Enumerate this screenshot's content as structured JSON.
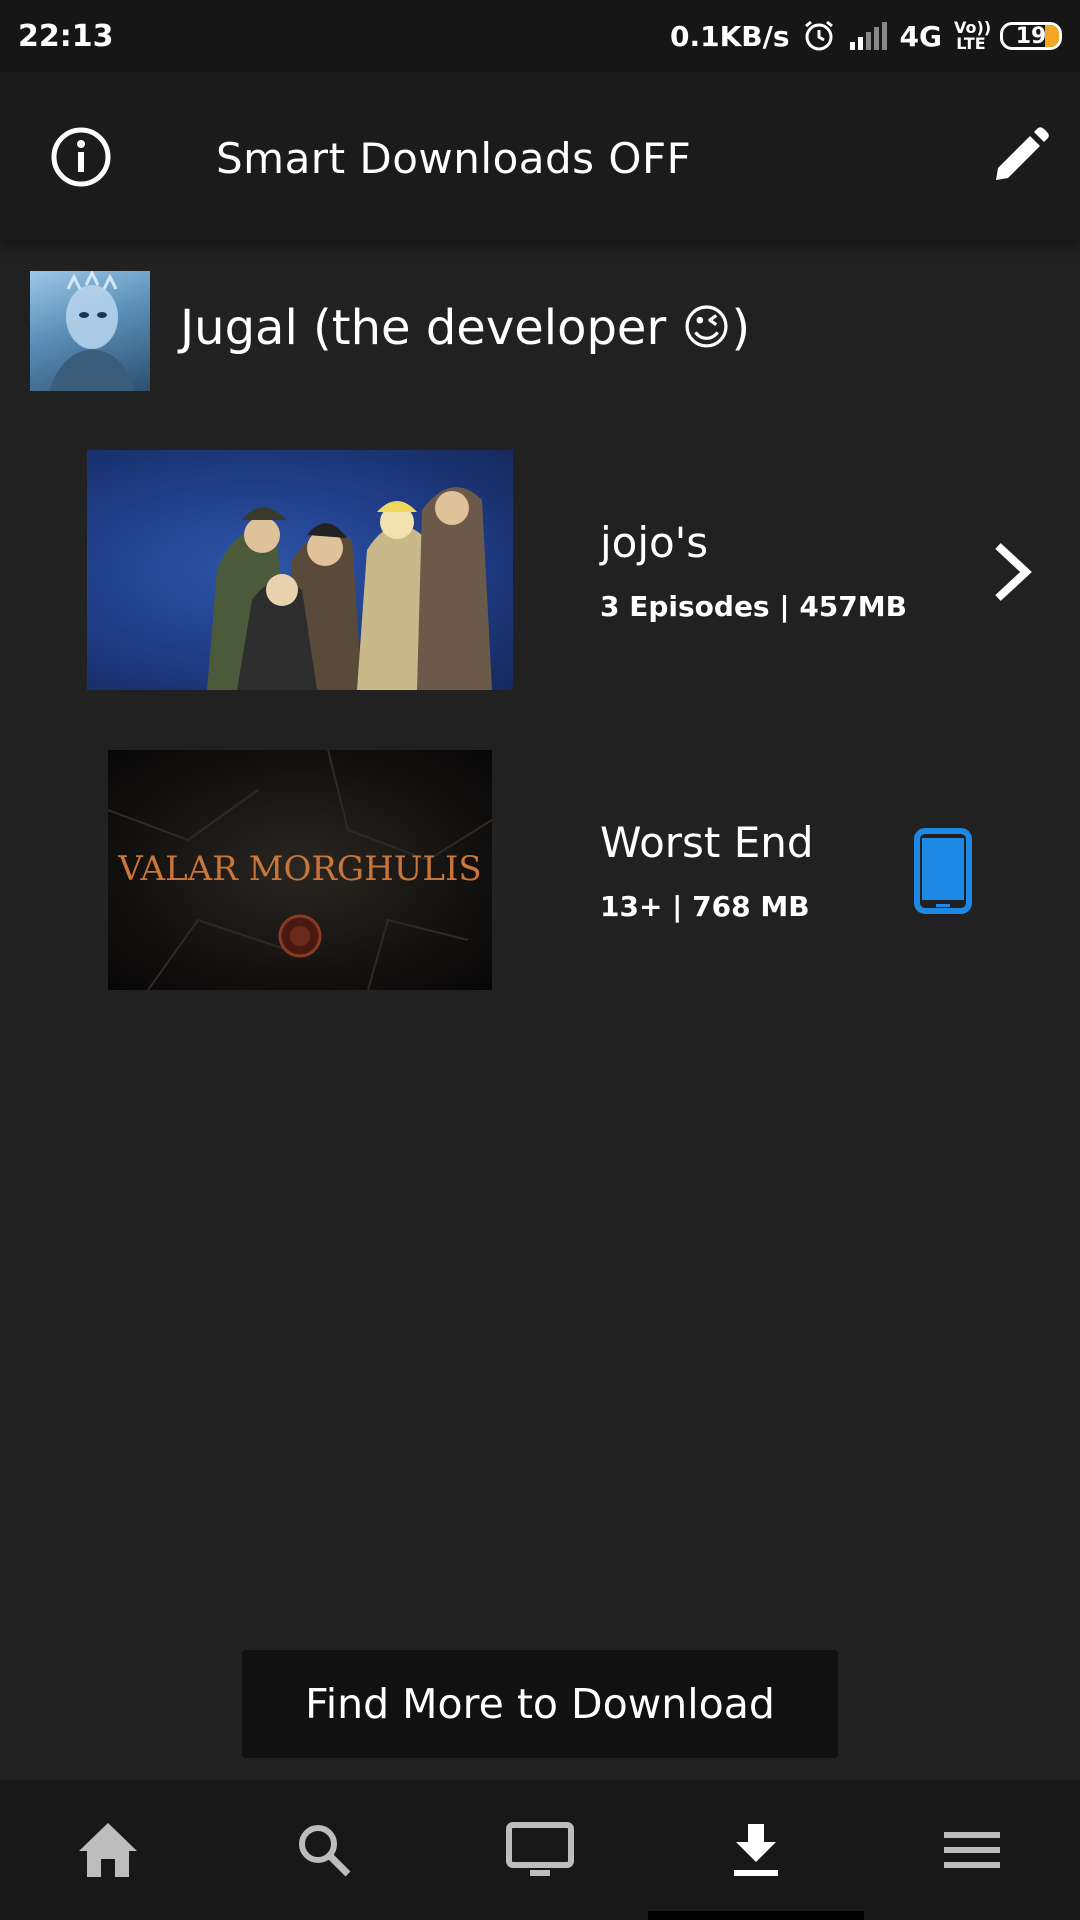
{
  "status_bar": {
    "time": "22:13",
    "net_speed": "0.1KB/s",
    "network": "4G",
    "volte": "Vo)) LTE",
    "battery": "19"
  },
  "header": {
    "title": "Smart Downloads OFF",
    "info_icon": "info-icon",
    "edit_icon": "pencil-icon"
  },
  "profile": {
    "name": "Jugal (the developer 😉)"
  },
  "downloads": [
    {
      "title": "jojo's",
      "meta": "3 Episodes | 457MB",
      "action_icon": "chevron-right-icon"
    },
    {
      "title": "Worst End",
      "meta": "13+ | 768 MB",
      "action_icon": "smartphone-icon",
      "thumb_text": "VALAR MORGHULIS"
    }
  ],
  "find_more": "Find More to Download",
  "nav": [
    "home-icon",
    "search-icon",
    "tv-icon",
    "download-icon",
    "menu-icon"
  ],
  "colors": {
    "background": "#212121",
    "accent_device": "#1e88e5",
    "battery": "#f5a623"
  }
}
